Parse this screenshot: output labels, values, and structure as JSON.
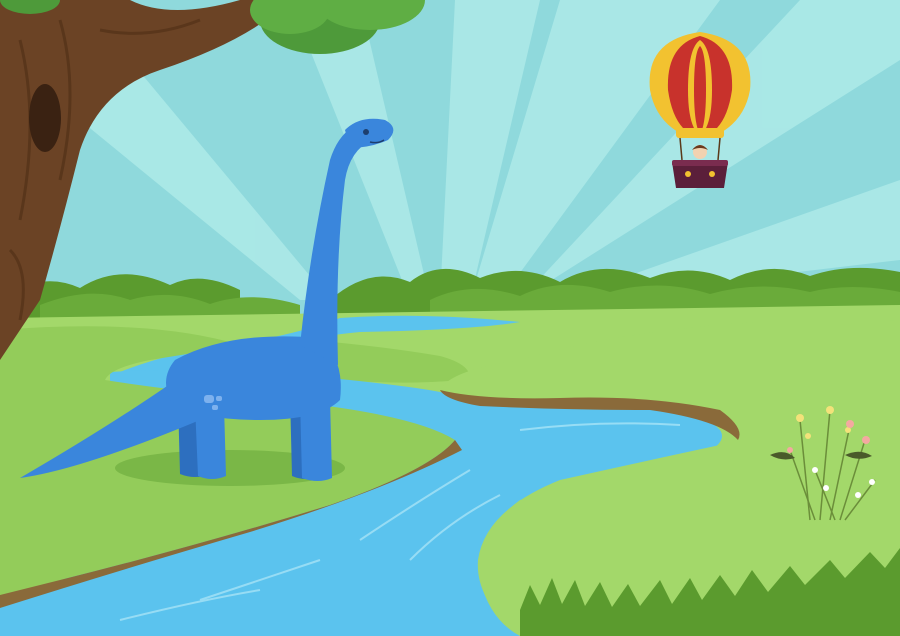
{
  "scene": {
    "subjects": [
      {
        "name": "brachiosaurus",
        "color": "#3a86dc"
      },
      {
        "name": "hot-air-balloon",
        "stripe_colors": [
          "#c8322c",
          "#f2c230"
        ]
      },
      {
        "name": "oak-tree"
      },
      {
        "name": "river",
        "color": "#5bc3ee"
      },
      {
        "name": "wildflowers"
      }
    ],
    "palette": {
      "sky": "#8fd9dc",
      "sky_rays": "#b2ecea",
      "far_hills": "#5b9b2e",
      "meadow": "#93cc5a",
      "meadow_light": "#a8db70",
      "river": "#5bc3ee",
      "bank": "#8a6a3a",
      "tree_trunk": "#6b4325",
      "foliage": "#4e9a3a"
    }
  }
}
